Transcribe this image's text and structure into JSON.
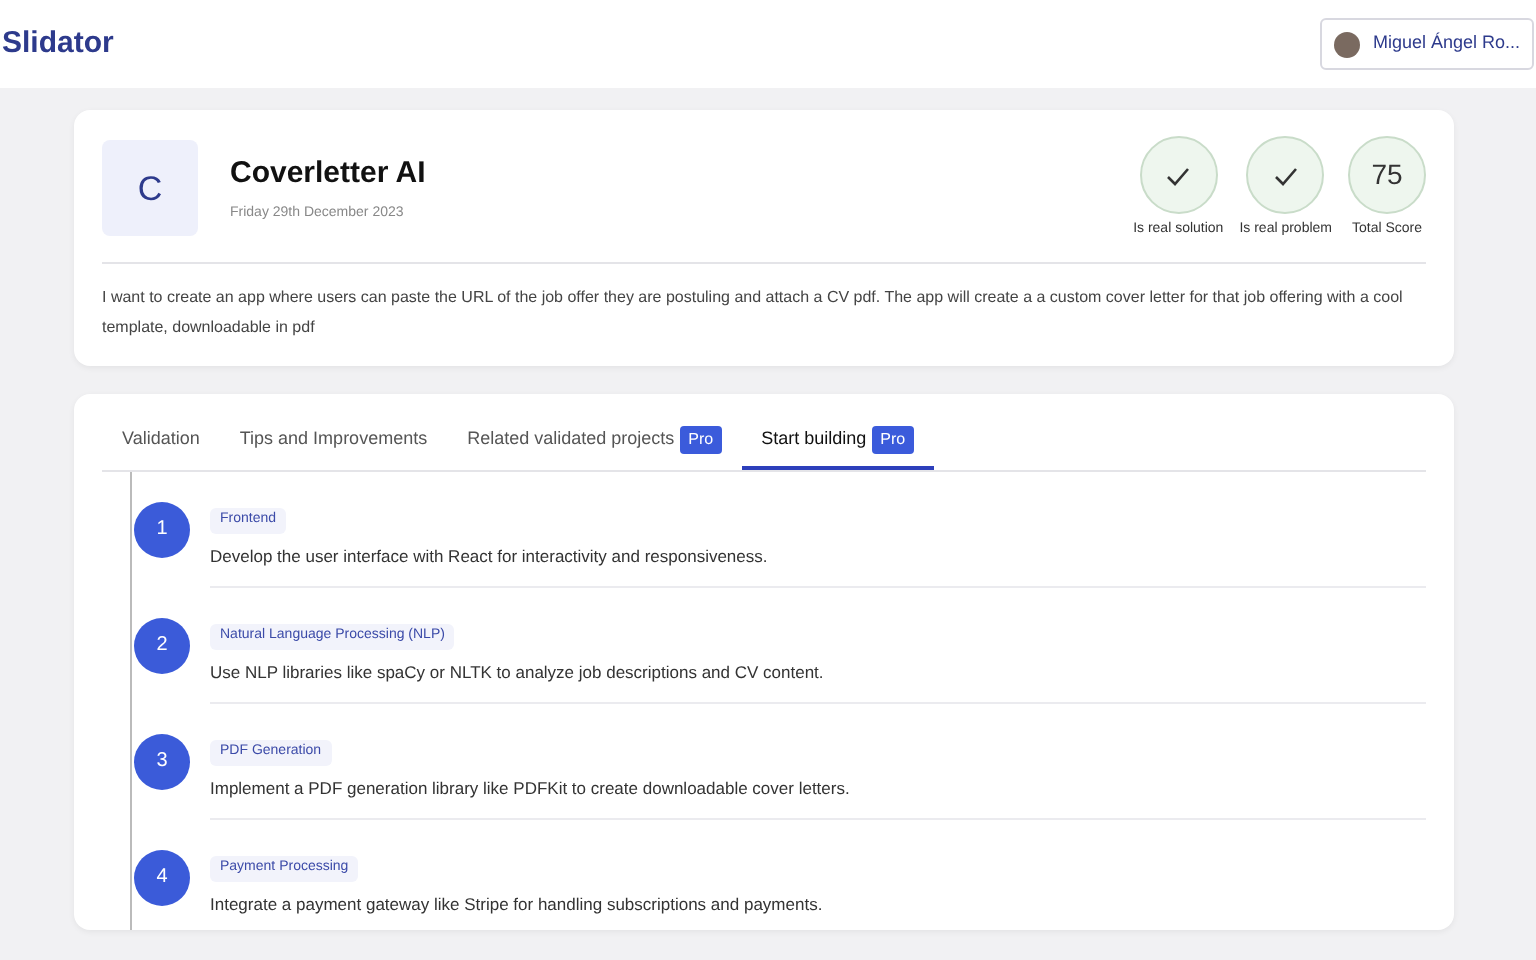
{
  "header": {
    "brand": "Slidator",
    "user": {
      "name": "Miguel Ángel Ro..."
    }
  },
  "idea": {
    "initial": "C",
    "title": "Coverletter AI",
    "date": "Friday 29th December 2023",
    "scores": [
      {
        "kind": "check",
        "label": "Is real solution"
      },
      {
        "kind": "check",
        "label": "Is real problem"
      },
      {
        "kind": "number",
        "value": "75",
        "label": "Total Score"
      }
    ],
    "description": "I want to create an app where users can paste the URL of the job offer they are postuling and attach a CV pdf. The app will create a a custom cover letter for that job offering with a cool template, downloadable in pdf"
  },
  "tabs": [
    {
      "label": "Validation",
      "selected": false
    },
    {
      "label": "Tips and Improvements",
      "selected": false
    },
    {
      "label": "Related validated projects",
      "badge": "Pro",
      "selected": false
    },
    {
      "label": "Start building",
      "badge": "Pro",
      "selected": true
    }
  ],
  "steps": [
    {
      "number": "1",
      "tag": "Frontend",
      "text": "Develop the user interface with React for interactivity and responsiveness."
    },
    {
      "number": "2",
      "tag": "Natural Language Processing (NLP)",
      "text": "Use NLP libraries like spaCy or NLTK to analyze job descriptions and CV content."
    },
    {
      "number": "3",
      "tag": "PDF Generation",
      "text": "Implement a PDF generation library like PDFKit to create downloadable cover letters."
    },
    {
      "number": "4",
      "tag": "Payment Processing",
      "text": "Integrate a payment gateway like Stripe for handling subscriptions and payments."
    }
  ]
}
